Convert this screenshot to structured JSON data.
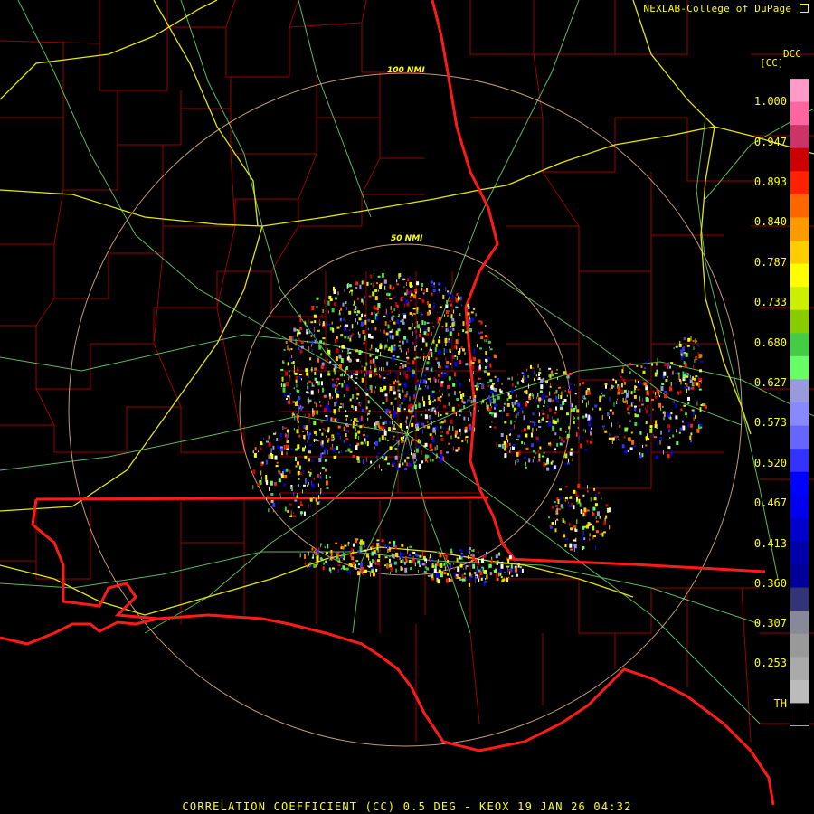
{
  "header": {
    "credit": "NEXLAB-College of DuPage",
    "credit_icon": "external-link-icon"
  },
  "legend": {
    "product_code": "DCC",
    "units": "[CC]",
    "tick_labels": [
      "1.000",
      "0.947",
      "0.893",
      "0.840",
      "0.787",
      "0.733",
      "0.680",
      "0.627",
      "0.573",
      "0.520",
      "0.467",
      "0.413",
      "0.360",
      "0.307",
      "0.253",
      "TH"
    ],
    "colors": [
      "#ff99c8",
      "#ff66a0",
      "#cc3366",
      "#cc0000",
      "#ff2200",
      "#ff6600",
      "#ff9900",
      "#ffcc00",
      "#ffff00",
      "#ccee00",
      "#88cc00",
      "#44cc44",
      "#66ff66",
      "#9999dd",
      "#8888ff",
      "#6666ff",
      "#3333ff",
      "#0000ff",
      "#0000ee",
      "#0000cc",
      "#0000aa",
      "#000099",
      "#333377",
      "#888899",
      "#999999",
      "#aaaaaa",
      "#bbbbbb",
      "#000000"
    ]
  },
  "range_rings": {
    "inner_label": "50 NMI",
    "outer_label": "100 NMI"
  },
  "map_colors": {
    "county_lines": "#990000",
    "state_lines": "#ff0000",
    "interstates": "#e6e600",
    "highways": "#66cc66",
    "range_rings": "#ffcc99"
  },
  "caption": "CORRELATION COEFFICIENT (CC) 0.5 DEG - KEOX 19 JAN 26 04:32"
}
